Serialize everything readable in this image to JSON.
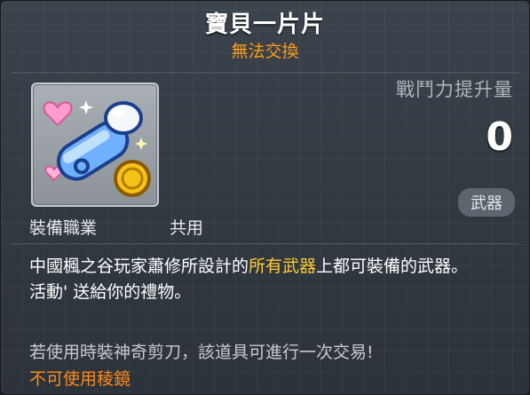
{
  "item": {
    "name": "寶貝一片片",
    "trade_status": "無法交換",
    "stat_label": "戰鬥力提升量",
    "stat_value": "0",
    "type_badge": "武器",
    "req_label": "裝備職業",
    "req_value": "共用",
    "description": {
      "part1": "中國楓之谷玩家蕭修所設計的",
      "highlight": "所有武器",
      "part2": "上都可裝備的武器。",
      "line2": "活動' 送給你的禮物。"
    },
    "scissors_note": "若使用時裝神奇剪刀，該道具可進行一次交易!",
    "prism_note": "不可使用稜鏡",
    "icon_name": "pacifier-icon"
  }
}
